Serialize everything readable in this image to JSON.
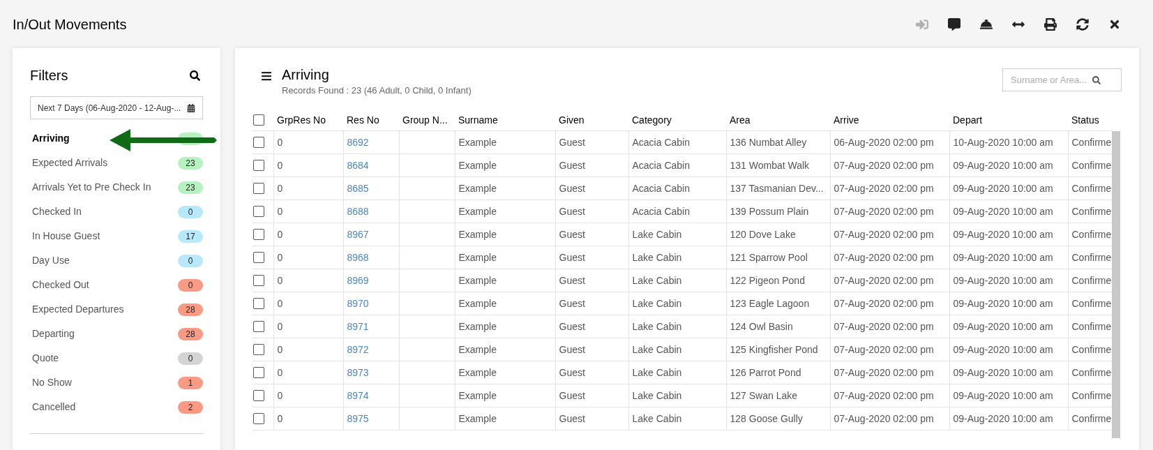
{
  "page": {
    "title": "In/Out Movements"
  },
  "toolbar": [
    {
      "kind": "sign-in",
      "disabled": true
    },
    {
      "kind": "comment",
      "disabled": false
    },
    {
      "kind": "bell",
      "disabled": false
    },
    {
      "kind": "expand",
      "disabled": false
    },
    {
      "kind": "print",
      "disabled": false
    },
    {
      "kind": "refresh",
      "disabled": false
    },
    {
      "kind": "close",
      "disabled": false
    }
  ],
  "filters": {
    "title": "Filters",
    "date_range": "Next 7 Days (06-Aug-2020 - 12-Aug-...",
    "items": [
      {
        "label": "Arriving",
        "selected": true,
        "color": "#b5f2c0"
      },
      {
        "label": "Expected Arrivals",
        "count": "23",
        "selected": false,
        "color": "#b5f2c0"
      },
      {
        "label": "Arrivals Yet to Pre Check In",
        "count": "23",
        "selected": false,
        "color": "#b5f2c0"
      },
      {
        "label": "Checked In",
        "count": "0",
        "selected": false,
        "color": "#b7e9fb"
      },
      {
        "label": "In House Guest",
        "count": "17",
        "selected": false,
        "color": "#b7e9fb"
      },
      {
        "label": "Day Use",
        "count": "0",
        "selected": false,
        "color": "#b7e9fb"
      },
      {
        "label": "Checked Out",
        "count": "0",
        "selected": false,
        "color": "#f89a84"
      },
      {
        "label": "Expected Departures",
        "count": "28",
        "selected": false,
        "color": "#f89a84"
      },
      {
        "label": "Departing",
        "count": "28",
        "selected": false,
        "color": "#f89a84"
      },
      {
        "label": "Quote",
        "count": "0",
        "selected": false,
        "color": "#d4d4d4"
      },
      {
        "label": "No Show",
        "count": "1",
        "selected": false,
        "color": "#f89a84"
      },
      {
        "label": "Cancelled",
        "count": "2",
        "selected": false,
        "color": "#f89a84"
      }
    ]
  },
  "main": {
    "title": "Arriving",
    "summary": "Records Found : 23 (46 Adult, 0 Child, 0 Infant)",
    "search": {
      "placeholder": "Surname or Area..."
    }
  },
  "table": {
    "columns": [
      "GrpRes No",
      "Res No",
      "Group N...",
      "Surname",
      "Given",
      "Category",
      "Area",
      "Arrive",
      "Depart",
      "Status"
    ],
    "select_all": {
      "checked": false
    },
    "rows": [
      {
        "checked": false,
        "cells": [
          "0",
          "8692",
          "",
          "Example",
          "Guest",
          "Acacia Cabin",
          "136 Numbat Alley",
          "06-Aug-2020 02:00 pm",
          "10-Aug-2020 10:00 am",
          "Confirme"
        ]
      },
      {
        "checked": false,
        "cells": [
          "0",
          "8684",
          "",
          "Example",
          "Guest",
          "Acacia Cabin",
          "131 Wombat Walk",
          "07-Aug-2020 02:00 pm",
          "09-Aug-2020 10:00 am",
          "Confirme"
        ]
      },
      {
        "checked": false,
        "cells": [
          "0",
          "8685",
          "",
          "Example",
          "Guest",
          "Acacia Cabin",
          "137 Tasmanian Dev...",
          "07-Aug-2020 02:00 pm",
          "09-Aug-2020 10:00 am",
          "Confirme"
        ]
      },
      {
        "checked": false,
        "cells": [
          "0",
          "8688",
          "",
          "Example",
          "Guest",
          "Acacia Cabin",
          "139 Possum Plain",
          "07-Aug-2020 02:00 pm",
          "09-Aug-2020 10:00 am",
          "Confirme"
        ]
      },
      {
        "checked": false,
        "cells": [
          "0",
          "8967",
          "",
          "Example",
          "Guest",
          "Lake Cabin",
          "120 Dove Lake",
          "07-Aug-2020 02:00 pm",
          "09-Aug-2020 10:00 am",
          "Confirme"
        ]
      },
      {
        "checked": false,
        "cells": [
          "0",
          "8968",
          "",
          "Example",
          "Guest",
          "Lake Cabin",
          "121 Sparrow Pool",
          "07-Aug-2020 02:00 pm",
          "09-Aug-2020 10:00 am",
          "Confirme"
        ]
      },
      {
        "checked": false,
        "cells": [
          "0",
          "8969",
          "",
          "Example",
          "Guest",
          "Lake Cabin",
          "122 Pigeon Pond",
          "07-Aug-2020 02:00 pm",
          "09-Aug-2020 10:00 am",
          "Confirme"
        ]
      },
      {
        "checked": false,
        "cells": [
          "0",
          "8970",
          "",
          "Example",
          "Guest",
          "Lake Cabin",
          "123 Eagle Lagoon",
          "07-Aug-2020 02:00 pm",
          "09-Aug-2020 10:00 am",
          "Confirme"
        ]
      },
      {
        "checked": false,
        "cells": [
          "0",
          "8971",
          "",
          "Example",
          "Guest",
          "Lake Cabin",
          "124 Owl Basin",
          "07-Aug-2020 02:00 pm",
          "09-Aug-2020 10:00 am",
          "Confirme"
        ]
      },
      {
        "checked": false,
        "cells": [
          "0",
          "8972",
          "",
          "Example",
          "Guest",
          "Lake Cabin",
          "125 Kingfisher Pond",
          "07-Aug-2020 02:00 pm",
          "09-Aug-2020 10:00 am",
          "Confirme"
        ]
      },
      {
        "checked": false,
        "cells": [
          "0",
          "8973",
          "",
          "Example",
          "Guest",
          "Lake Cabin",
          "126 Parrot Pond",
          "07-Aug-2020 02:00 pm",
          "09-Aug-2020 10:00 am",
          "Confirme"
        ]
      },
      {
        "checked": false,
        "cells": [
          "0",
          "8974",
          "",
          "Example",
          "Guest",
          "Lake Cabin",
          "127 Swan Lake",
          "07-Aug-2020 02:00 pm",
          "09-Aug-2020 10:00 am",
          "Confirme"
        ]
      },
      {
        "checked": false,
        "cells": [
          "0",
          "8975",
          "",
          "Example",
          "Guest",
          "Lake Cabin",
          "128 Goose Gully",
          "07-Aug-2020 02:00 pm",
          "09-Aug-2020 10:00 am",
          "Confirme"
        ]
      }
    ]
  }
}
